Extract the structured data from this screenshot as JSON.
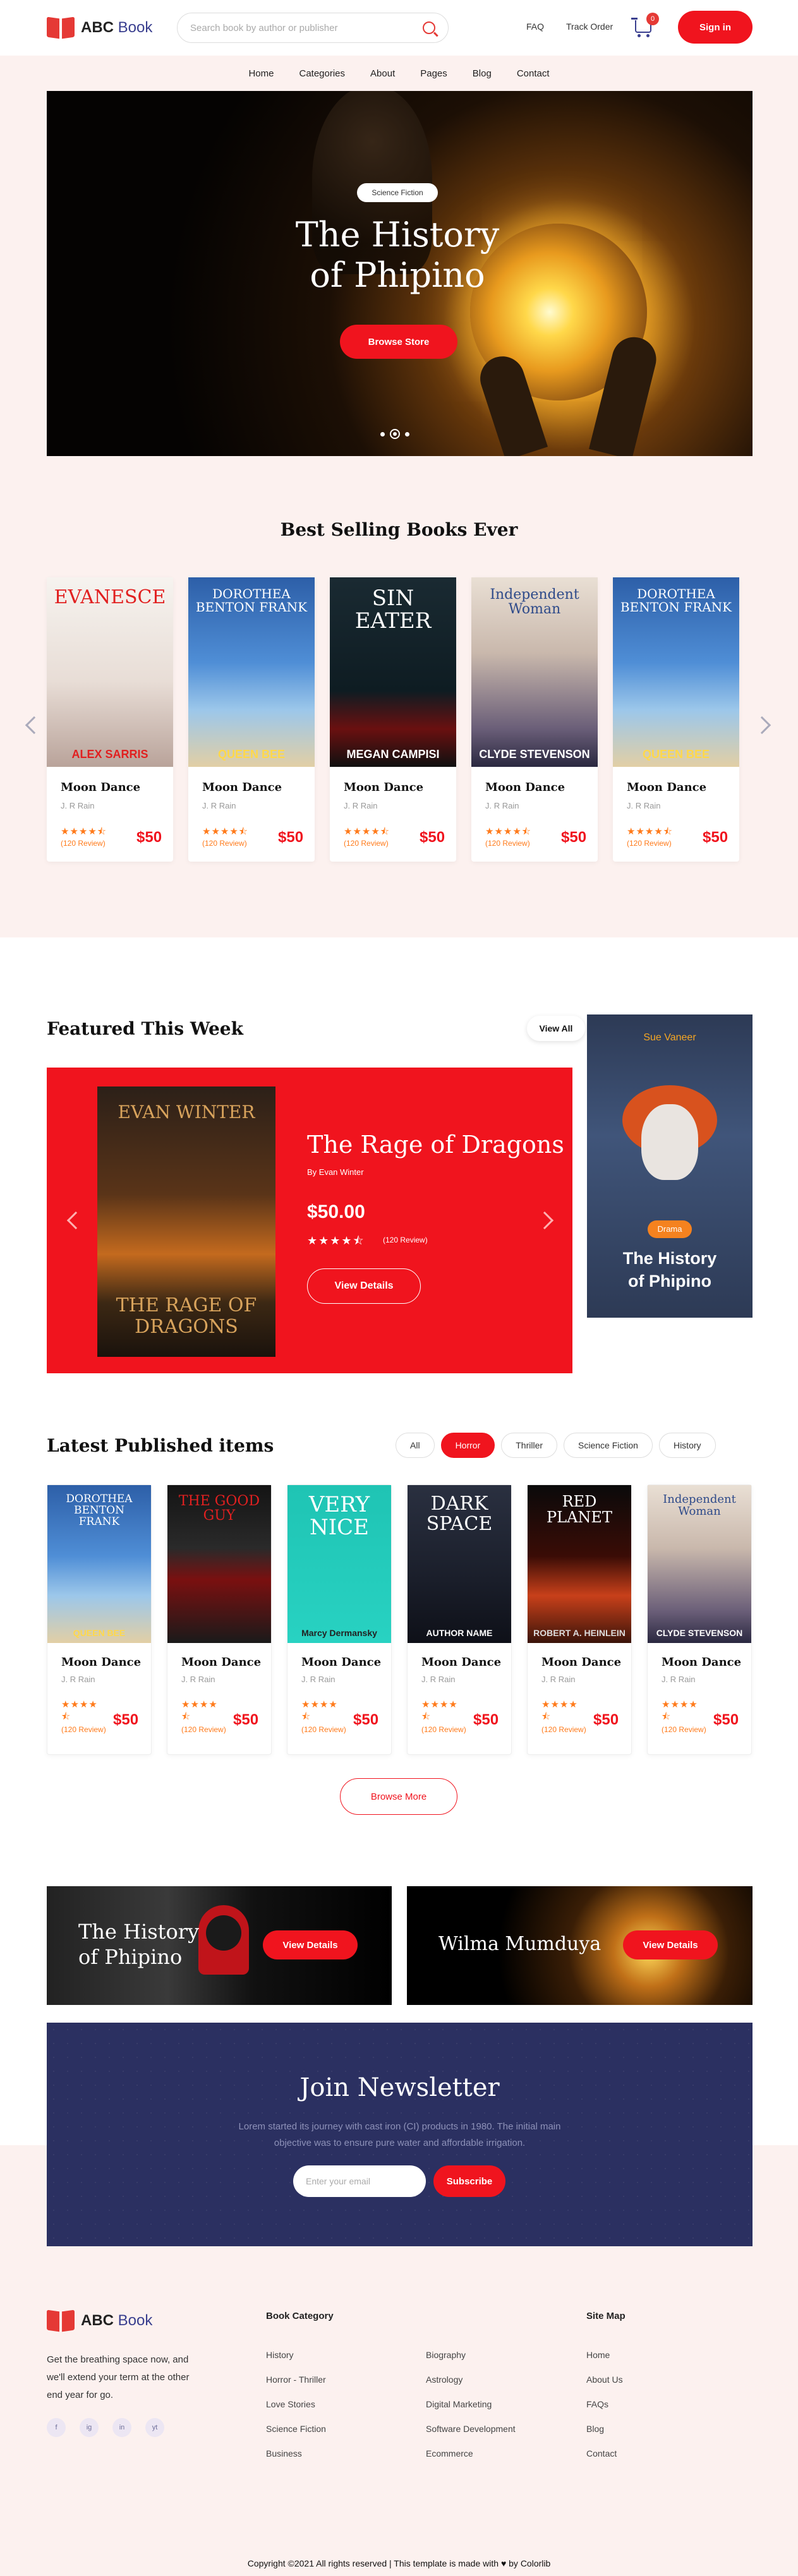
{
  "header": {
    "brand_part1": "ABC",
    "brand_part2": "Book",
    "search_placeholder": "Search book by author or publisher",
    "faq": "FAQ",
    "track_order": "Track Order",
    "cart_count": "0",
    "signin": "Sign in"
  },
  "nav": [
    "Home",
    "Categories",
    "About",
    "Pages",
    "Blog",
    "Contact"
  ],
  "hero": {
    "badge": "Science Fiction",
    "title_line1": "The History",
    "title_line2": "of Phipino",
    "button": "Browse Store"
  },
  "best_selling": {
    "title": "Best Selling Books Ever",
    "books": [
      {
        "cover_top": "EVANESCE",
        "cover_bottom": "ALEX SARRIS",
        "title": "Moon Dance",
        "author": "J. R Rain",
        "stars": "★★★★⯪",
        "review_count": "(120 Review)",
        "price": "$50"
      },
      {
        "cover_top": "DOROTHEA BENTON FRANK",
        "cover_bottom": "QUEEN BEE",
        "title": "Moon Dance",
        "author": "J. R Rain",
        "stars": "★★★★⯪",
        "review_count": "(120 Review)",
        "price": "$50"
      },
      {
        "cover_top": "SIN EATER",
        "cover_bottom": "MEGAN CAMPISI",
        "title": "Moon Dance",
        "author": "J. R Rain",
        "stars": "★★★★⯪",
        "review_count": "(120 Review)",
        "price": "$50"
      },
      {
        "cover_top": "Independent Woman",
        "cover_bottom": "CLYDE STEVENSON",
        "title": "Moon Dance",
        "author": "J. R Rain",
        "stars": "★★★★⯪",
        "review_count": "(120 Review)",
        "price": "$50"
      },
      {
        "cover_top": "DOROTHEA BENTON FRANK",
        "cover_bottom": "QUEEN BEE",
        "title": "Moon Dance",
        "author": "J. R Rain",
        "stars": "★★★★⯪",
        "review_count": "(120 Review)",
        "price": "$50"
      }
    ]
  },
  "featured": {
    "title": "Featured This Week",
    "view_all": "View All",
    "cover_author": "EVAN WINTER",
    "cover_title": "THE RAGE OF DRAGONS",
    "book_title": "The Rage of Dragons",
    "by": "By Evan Winter",
    "price": "$50.00",
    "stars": "★★★★⯪",
    "review_count": "(120 Review)",
    "button": "View Details",
    "side_ad": {
      "author": "Sue Vaneer",
      "tag": "Drama",
      "title_line1": "The History",
      "title_line2": "of Phipino"
    }
  },
  "latest": {
    "title": "Latest Published items",
    "filters": [
      "All",
      "Horror",
      "Thriller",
      "Science Fiction",
      "History"
    ],
    "active_filter": "Horror",
    "books": [
      {
        "cover_top": "DOROTHEA BENTON FRANK",
        "cover_bottom": "QUEEN BEE",
        "title": "Moon Dance",
        "author": "J. R Rain",
        "stars": "★★★★",
        "half": "⯪",
        "review_count": "(120 Review)",
        "price": "$50"
      },
      {
        "cover_top": "THE GOOD GUY",
        "cover_bottom": "",
        "title": "Moon Dance",
        "author": "J. R Rain",
        "stars": "★★★★",
        "half": "⯪",
        "review_count": "(120 Review)",
        "price": "$50"
      },
      {
        "cover_top": "VERY NICE",
        "cover_bottom": "Marcy Dermansky",
        "title": "Moon Dance",
        "author": "J. R Rain",
        "stars": "★★★★",
        "half": "⯪",
        "review_count": "(120 Review)",
        "price": "$50"
      },
      {
        "cover_top": "DARK SPACE",
        "cover_bottom": "AUTHOR NAME",
        "title": "Moon Dance",
        "author": "J. R Rain",
        "stars": "★★★★",
        "half": "⯪",
        "review_count": "(120 Review)",
        "price": "$50"
      },
      {
        "cover_top": "RED PLANET",
        "cover_bottom": "ROBERT A. HEINLEIN",
        "title": "Moon Dance",
        "author": "J. R Rain",
        "stars": "★★★★",
        "half": "⯪",
        "review_count": "(120 Review)",
        "price": "$50"
      },
      {
        "cover_top": "Independent Woman",
        "cover_bottom": "CLYDE STEVENSON",
        "title": "Moon Dance",
        "author": "J. R Rain",
        "stars": "★★★★",
        "half": "⯪",
        "review_count": "(120 Review)",
        "price": "$50"
      }
    ],
    "browse_more": "Browse More"
  },
  "banners": [
    {
      "title_line1": "The History",
      "title_line2": "of Phipino",
      "button": "View Details"
    },
    {
      "title_line1": "Wilma Mumduya",
      "title_line2": "",
      "button": "View Details"
    }
  ],
  "newsletter": {
    "title": "Join Newsletter",
    "text": "Lorem started its journey with cast iron (CI) products in 1980. The initial main objective was to ensure pure water and affordable irrigation.",
    "placeholder": "Enter your email",
    "button": "Subscribe"
  },
  "footer": {
    "brand_part1": "ABC",
    "brand_part2": "Book",
    "description": "Get the breathing space now, and we'll extend your term at the other end year for go.",
    "socials": [
      "f",
      "ig",
      "in",
      "yt"
    ],
    "category_heading": "Book Category",
    "category_col1": [
      "History",
      "Horror - Thriller",
      "Love Stories",
      "Science Fiction",
      "Business"
    ],
    "category_col2": [
      "Biography",
      "Astrology",
      "Digital Marketing",
      "Software Development",
      "Ecommerce"
    ],
    "sitemap_heading": "Site Map",
    "sitemap": [
      "Home",
      "About Us",
      "FAQs",
      "Blog",
      "Contact"
    ],
    "copyright_prefix": "Copyright ©2021 All rights reserved | This template is made with",
    "copyright_suffix": "by Colorlib"
  },
  "colors": {
    "accent": "#f0141e",
    "navy": "#2b3061",
    "pink_bg": "#fcf1ef",
    "star": "#ff7a1a"
  }
}
